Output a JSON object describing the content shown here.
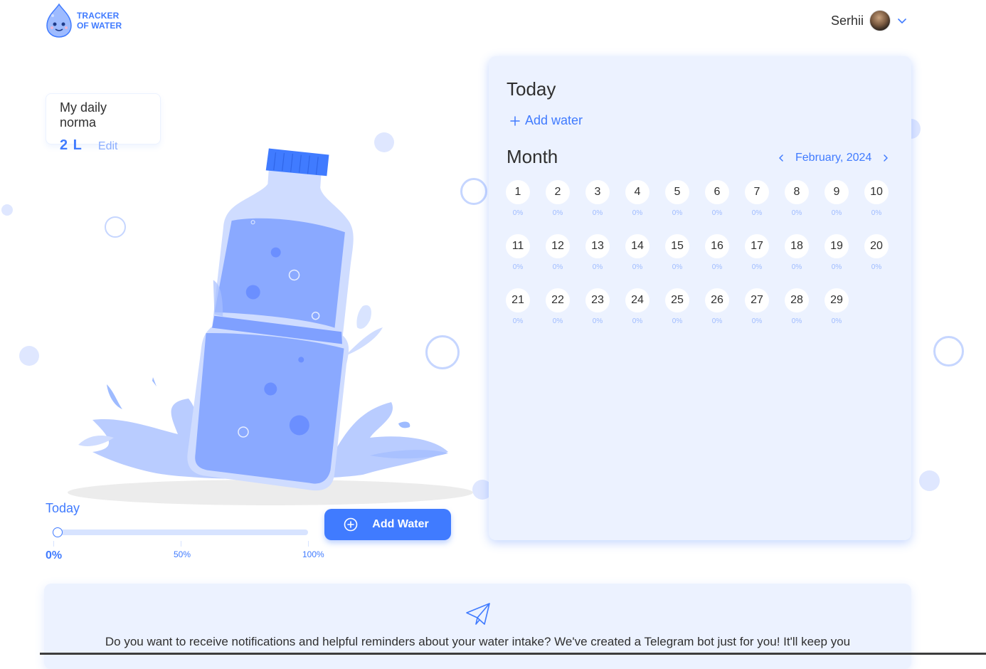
{
  "header": {
    "logo_line1": "TRACKER",
    "logo_line2": "OF WATER",
    "user_name": "Serhii",
    "avatar_icon": "avatar",
    "dropdown_icon": "chevron-down-icon"
  },
  "daily_norma": {
    "title": "My daily norma",
    "value": "2 L",
    "edit_label": "Edit"
  },
  "progress": {
    "label": "Today",
    "value_percent": 0,
    "current_label": "0%",
    "mid_label": "50%",
    "max_label": "100%"
  },
  "add_water_button": {
    "label": "Add Water",
    "icon": "plus-circle-icon"
  },
  "today_panel": {
    "title": "Today",
    "add_water_label": "Add water",
    "add_icon": "plus-icon"
  },
  "month": {
    "title": "Month",
    "month_label": "February,",
    "year_label": "2024",
    "prev_icon": "chevron-left-icon",
    "next_icon": "chevron-right-icon",
    "days": [
      {
        "day": "1",
        "percent": "0%"
      },
      {
        "day": "2",
        "percent": "0%"
      },
      {
        "day": "3",
        "percent": "0%"
      },
      {
        "day": "4",
        "percent": "0%"
      },
      {
        "day": "5",
        "percent": "0%"
      },
      {
        "day": "6",
        "percent": "0%"
      },
      {
        "day": "7",
        "percent": "0%"
      },
      {
        "day": "8",
        "percent": "0%"
      },
      {
        "day": "9",
        "percent": "0%"
      },
      {
        "day": "10",
        "percent": "0%"
      },
      {
        "day": "11",
        "percent": "0%"
      },
      {
        "day": "12",
        "percent": "0%"
      },
      {
        "day": "13",
        "percent": "0%"
      },
      {
        "day": "14",
        "percent": "0%"
      },
      {
        "day": "15",
        "percent": "0%"
      },
      {
        "day": "16",
        "percent": "0%"
      },
      {
        "day": "17",
        "percent": "0%"
      },
      {
        "day": "18",
        "percent": "0%"
      },
      {
        "day": "19",
        "percent": "0%"
      },
      {
        "day": "20",
        "percent": "0%"
      },
      {
        "day": "21",
        "percent": "0%"
      },
      {
        "day": "22",
        "percent": "0%"
      },
      {
        "day": "23",
        "percent": "0%"
      },
      {
        "day": "24",
        "percent": "0%"
      },
      {
        "day": "25",
        "percent": "0%"
      },
      {
        "day": "26",
        "percent": "0%"
      },
      {
        "day": "27",
        "percent": "0%"
      },
      {
        "day": "28",
        "percent": "0%"
      },
      {
        "day": "29",
        "percent": "0%"
      }
    ]
  },
  "telegram": {
    "icon": "paper-plane-icon",
    "text": "Do you want to receive notifications and helpful reminders about your water intake? We've created a Telegram bot just for you! It'll keep you"
  },
  "colors": {
    "accent": "#407bff",
    "panel_bg": "#ecf2ff",
    "bottle_light": "#9ebbff"
  }
}
